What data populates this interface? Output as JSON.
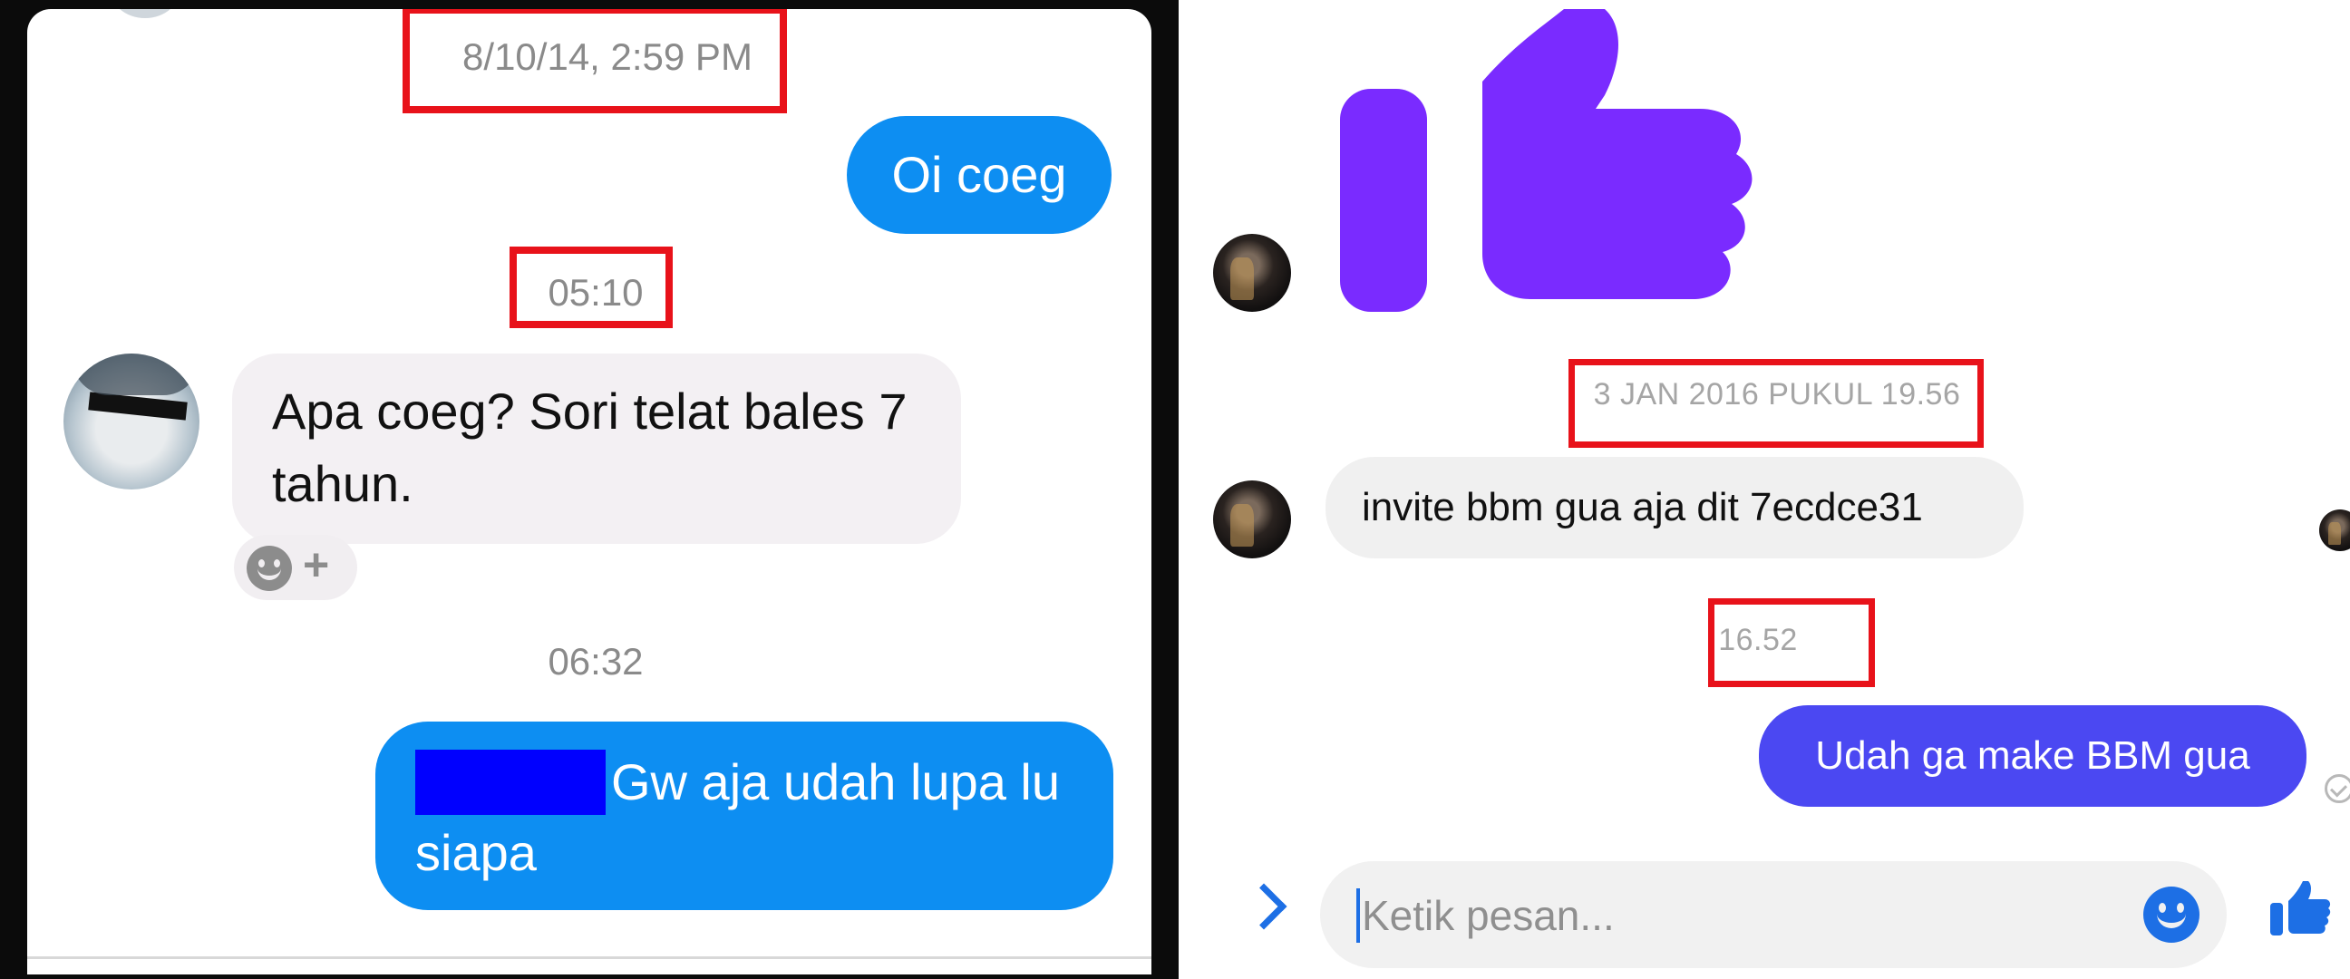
{
  "left_chat": {
    "timestamps": [
      "8/10/14, 2:59 PM",
      "05:10",
      "06:32"
    ],
    "messages": [
      {
        "text": "Oi coeg"
      },
      {
        "line1": "Apa coeg? Sori telat bales 7",
        "line2": "tahun."
      },
      {
        "line1": "Gw aja udah lupa lu",
        "line2": "siapa"
      }
    ],
    "reaction": {
      "add": "+"
    }
  },
  "right_chat": {
    "timestamps": [
      "3 JAN 2016 PUKUL 19.56",
      "16.52"
    ],
    "incoming": "invite bbm gua aja dit 7ecdce31",
    "outgoing": "Udah ga make BBM gua",
    "composer": {
      "placeholder": "Ketik pesan..."
    },
    "colors": {
      "like_large": "#7a2bff",
      "outgoing_bubble": "#4b48f2",
      "accent": "#1d6fe5"
    }
  },
  "annotation_color": "#e8121a",
  "redaction_color": "#0000ff"
}
